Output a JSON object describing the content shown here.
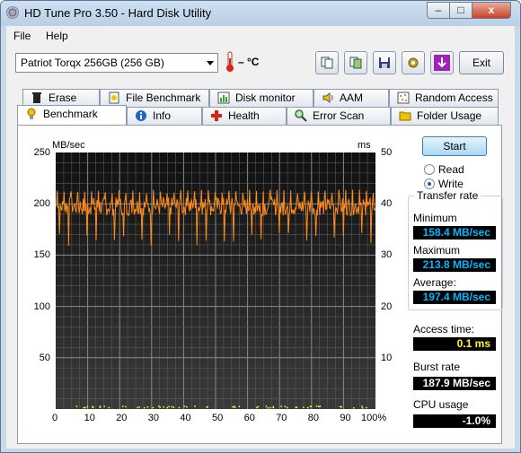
{
  "window": {
    "title": "HD Tune Pro 3.50 - Hard Disk Utility",
    "controls": {
      "minimize": "–",
      "maximize": "□",
      "close": "x"
    }
  },
  "menu": {
    "file": "File",
    "help": "Help"
  },
  "toolbar": {
    "drive": "Patriot Torqx 256GB (256 GB)",
    "temperature": "– °C",
    "exit_label": "Exit",
    "tools": [
      "copy-info-icon",
      "copy-screen-icon",
      "save-icon",
      "options-icon",
      "download-icon"
    ]
  },
  "tabs_top": [
    "Erase",
    "File Benchmark",
    "Disk monitor",
    "AAM",
    "Random Access"
  ],
  "tabs_bottom": [
    "Benchmark",
    "Info",
    "Health",
    "Error Scan",
    "Folder Usage"
  ],
  "active_tab": "Benchmark",
  "benchmark": {
    "start_label": "Start",
    "read_label": "Read",
    "write_label": "Write",
    "selected_mode": "Write",
    "transfer_rate_title": "Transfer rate",
    "minimum_label": "Minimum",
    "minimum_value": "158.4 MB/sec",
    "maximum_label": "Maximum",
    "maximum_value": "213.8 MB/sec",
    "average_label": "Average:",
    "average_value": "197.4 MB/sec",
    "access_label": "Access time:",
    "access_value": "0.1 ms",
    "burst_label": "Burst rate",
    "burst_value": "187.9 MB/sec",
    "cpu_label": "CPU usage",
    "cpu_value": "-1.0%"
  },
  "chart_data": {
    "type": "line",
    "left_unit": "MB/sec",
    "right_unit": "ms",
    "left_ticks": [
      "250",
      "200",
      "150",
      "100",
      "50"
    ],
    "right_ticks": [
      "50",
      "40",
      "30",
      "20",
      "10"
    ],
    "x_ticks": [
      "0",
      "10",
      "20",
      "30",
      "40",
      "50",
      "60",
      "70",
      "80",
      "90",
      "100%"
    ],
    "ylim": [
      0,
      250
    ],
    "xlim": [
      0,
      100
    ],
    "series": [
      {
        "name": "",
        "color": "#ff8c1a",
        "approx_mean": 197.4,
        "min": 158.4,
        "max": 213.8
      }
    ]
  }
}
